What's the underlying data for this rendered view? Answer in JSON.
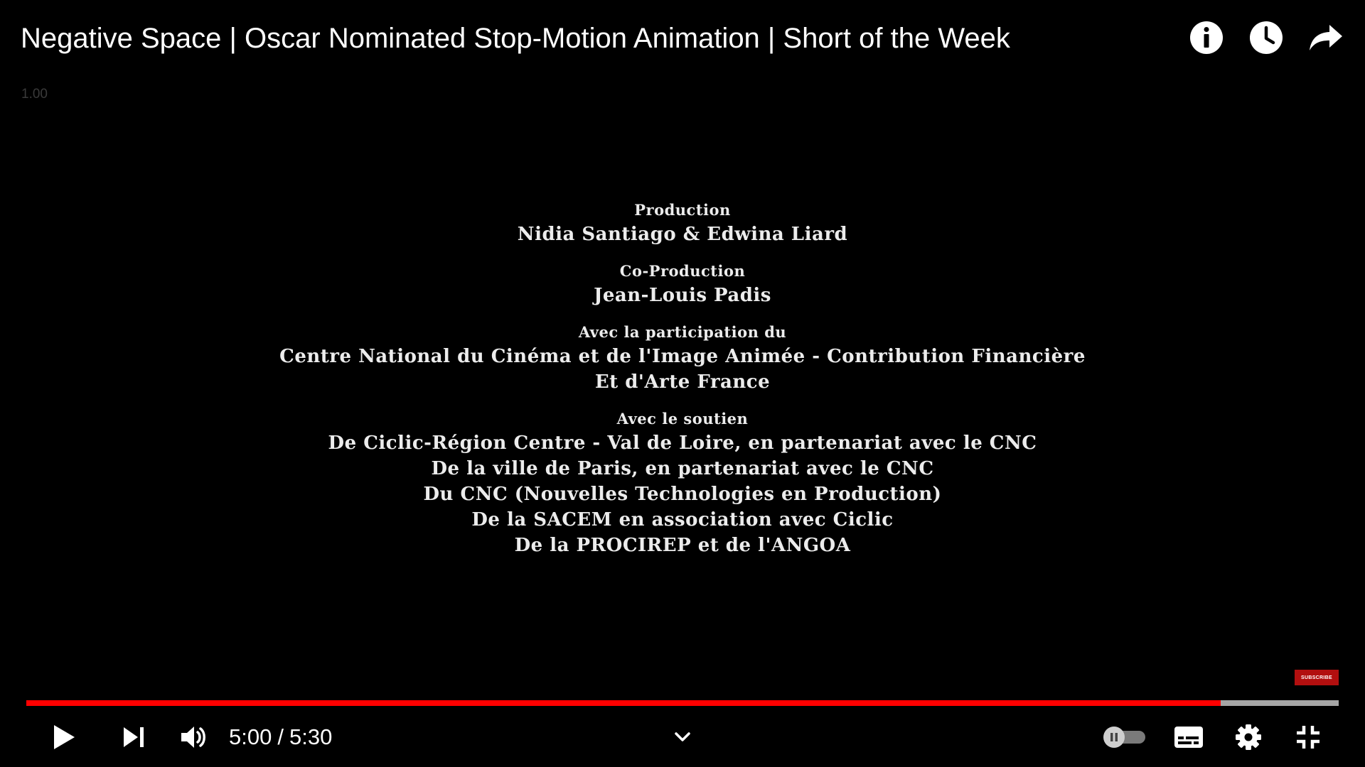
{
  "video": {
    "title": "Negative Space | Oscar Nominated Stop-Motion Animation | Short of the Week",
    "speed_label": "1.00"
  },
  "top_icons": [
    "info-icon",
    "watch-later-icon",
    "share-icon"
  ],
  "credits": [
    {
      "role": "Production",
      "lines": [
        "Nidia Santiago & Edwina Liard"
      ]
    },
    {
      "role": "Co-Production",
      "lines": [
        "Jean-Louis Padis"
      ]
    },
    {
      "role": "Avec la participation du",
      "lines": [
        "Centre National du Cinéma et de l'Image Animée - Contribution Financière",
        "Et d'Arte France"
      ]
    },
    {
      "role": "Avec le soutien",
      "lines": [
        "De Ciclic-Région Centre - Val de Loire, en partenariat avec le CNC",
        "De la ville de Paris, en partenariat avec le CNC",
        "Du CNC (Nouvelles Technologies en Production)",
        "De la SACEM en association avec Ciclic",
        "De la PROCIREP et de l'ANGOA"
      ]
    }
  ],
  "subscribe_label": "SUBSCRIBE",
  "playback": {
    "current_time": "5:00",
    "separator": "/",
    "duration": "5:30",
    "progress_fraction": 0.9103
  },
  "colors": {
    "progress_played": "#ff0000",
    "progress_remaining": "#a6a6a6",
    "subscribe_bg": "#b20f0f"
  }
}
